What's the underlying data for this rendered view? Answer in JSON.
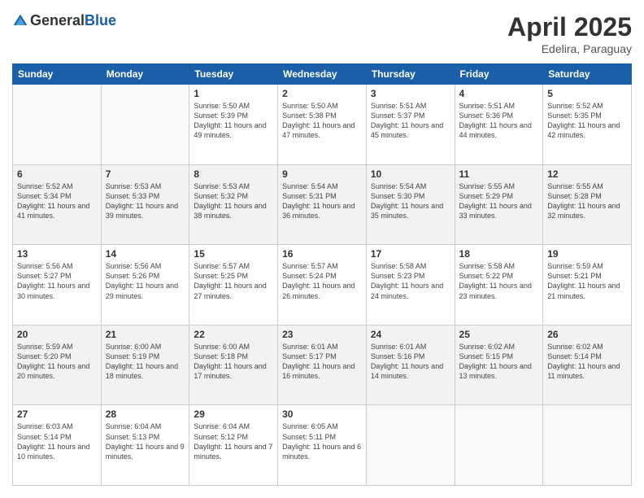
{
  "logo": {
    "general": "General",
    "blue": "Blue"
  },
  "header": {
    "month": "April 2025",
    "location": "Edelira, Paraguay"
  },
  "weekdays": [
    "Sunday",
    "Monday",
    "Tuesday",
    "Wednesday",
    "Thursday",
    "Friday",
    "Saturday"
  ],
  "weeks": [
    [
      {
        "day": null
      },
      {
        "day": null
      },
      {
        "day": "1",
        "sunrise": "5:50 AM",
        "sunset": "5:39 PM",
        "daylight": "11 hours and 49 minutes."
      },
      {
        "day": "2",
        "sunrise": "5:50 AM",
        "sunset": "5:38 PM",
        "daylight": "11 hours and 47 minutes."
      },
      {
        "day": "3",
        "sunrise": "5:51 AM",
        "sunset": "5:37 PM",
        "daylight": "11 hours and 45 minutes."
      },
      {
        "day": "4",
        "sunrise": "5:51 AM",
        "sunset": "5:36 PM",
        "daylight": "11 hours and 44 minutes."
      },
      {
        "day": "5",
        "sunrise": "5:52 AM",
        "sunset": "5:35 PM",
        "daylight": "11 hours and 42 minutes."
      }
    ],
    [
      {
        "day": "6",
        "sunrise": "5:52 AM",
        "sunset": "5:34 PM",
        "daylight": "11 hours and 41 minutes."
      },
      {
        "day": "7",
        "sunrise": "5:53 AM",
        "sunset": "5:33 PM",
        "daylight": "11 hours and 39 minutes."
      },
      {
        "day": "8",
        "sunrise": "5:53 AM",
        "sunset": "5:32 PM",
        "daylight": "11 hours and 38 minutes."
      },
      {
        "day": "9",
        "sunrise": "5:54 AM",
        "sunset": "5:31 PM",
        "daylight": "11 hours and 36 minutes."
      },
      {
        "day": "10",
        "sunrise": "5:54 AM",
        "sunset": "5:30 PM",
        "daylight": "11 hours and 35 minutes."
      },
      {
        "day": "11",
        "sunrise": "5:55 AM",
        "sunset": "5:29 PM",
        "daylight": "11 hours and 33 minutes."
      },
      {
        "day": "12",
        "sunrise": "5:55 AM",
        "sunset": "5:28 PM",
        "daylight": "11 hours and 32 minutes."
      }
    ],
    [
      {
        "day": "13",
        "sunrise": "5:56 AM",
        "sunset": "5:27 PM",
        "daylight": "11 hours and 30 minutes."
      },
      {
        "day": "14",
        "sunrise": "5:56 AM",
        "sunset": "5:26 PM",
        "daylight": "11 hours and 29 minutes."
      },
      {
        "day": "15",
        "sunrise": "5:57 AM",
        "sunset": "5:25 PM",
        "daylight": "11 hours and 27 minutes."
      },
      {
        "day": "16",
        "sunrise": "5:57 AM",
        "sunset": "5:24 PM",
        "daylight": "11 hours and 26 minutes."
      },
      {
        "day": "17",
        "sunrise": "5:58 AM",
        "sunset": "5:23 PM",
        "daylight": "11 hours and 24 minutes."
      },
      {
        "day": "18",
        "sunrise": "5:58 AM",
        "sunset": "5:22 PM",
        "daylight": "11 hours and 23 minutes."
      },
      {
        "day": "19",
        "sunrise": "5:59 AM",
        "sunset": "5:21 PM",
        "daylight": "11 hours and 21 minutes."
      }
    ],
    [
      {
        "day": "20",
        "sunrise": "5:59 AM",
        "sunset": "5:20 PM",
        "daylight": "11 hours and 20 minutes."
      },
      {
        "day": "21",
        "sunrise": "6:00 AM",
        "sunset": "5:19 PM",
        "daylight": "11 hours and 18 minutes."
      },
      {
        "day": "22",
        "sunrise": "6:00 AM",
        "sunset": "5:18 PM",
        "daylight": "11 hours and 17 minutes."
      },
      {
        "day": "23",
        "sunrise": "6:01 AM",
        "sunset": "5:17 PM",
        "daylight": "11 hours and 16 minutes."
      },
      {
        "day": "24",
        "sunrise": "6:01 AM",
        "sunset": "5:16 PM",
        "daylight": "11 hours and 14 minutes."
      },
      {
        "day": "25",
        "sunrise": "6:02 AM",
        "sunset": "5:15 PM",
        "daylight": "11 hours and 13 minutes."
      },
      {
        "day": "26",
        "sunrise": "6:02 AM",
        "sunset": "5:14 PM",
        "daylight": "11 hours and 11 minutes."
      }
    ],
    [
      {
        "day": "27",
        "sunrise": "6:03 AM",
        "sunset": "5:14 PM",
        "daylight": "11 hours and 10 minutes."
      },
      {
        "day": "28",
        "sunrise": "6:04 AM",
        "sunset": "5:13 PM",
        "daylight": "11 hours and 9 minutes."
      },
      {
        "day": "29",
        "sunrise": "6:04 AM",
        "sunset": "5:12 PM",
        "daylight": "11 hours and 7 minutes."
      },
      {
        "day": "30",
        "sunrise": "6:05 AM",
        "sunset": "5:11 PM",
        "daylight": "11 hours and 6 minutes."
      },
      {
        "day": null
      },
      {
        "day": null
      },
      {
        "day": null
      }
    ]
  ]
}
